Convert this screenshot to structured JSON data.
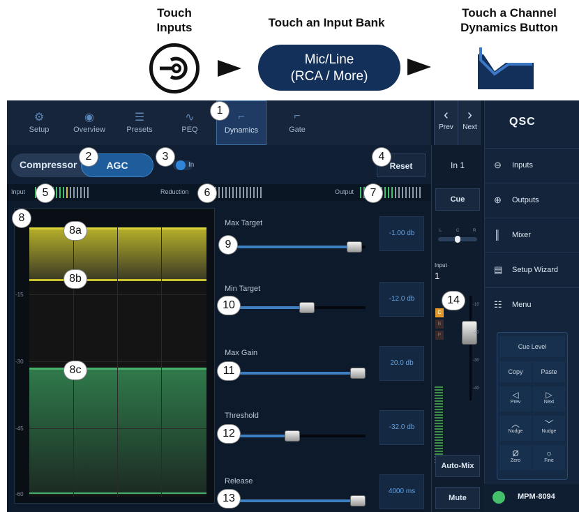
{
  "instructions": {
    "step1": "Touch\nInputs",
    "step2": "Touch an Input Bank",
    "step3": "Touch a Channel\nDynamics Button",
    "bank_button": "Mic/Line\n(RCA / More)"
  },
  "tabs": [
    {
      "label": "Setup",
      "icon": "gear-icon"
    },
    {
      "label": "Overview",
      "icon": "eye-icon"
    },
    {
      "label": "Presets",
      "icon": "sliders-icon"
    },
    {
      "label": "PEQ",
      "icon": "eq-curve-icon"
    },
    {
      "label": "Dynamics",
      "icon": "dynamics-icon",
      "active": true
    },
    {
      "label": "Gate",
      "icon": "gate-icon"
    }
  ],
  "nav": {
    "prev": "Prev",
    "next": "Next"
  },
  "mode": {
    "compressor": "Compressor",
    "agc": "AGC",
    "toggle_label": "In",
    "reset": "Reset"
  },
  "meters": {
    "input": "Input",
    "reduction": "Reduction",
    "output": "Output"
  },
  "graph": {
    "ticks": [
      "-15",
      "-30",
      "-45",
      "-60"
    ]
  },
  "params": [
    {
      "label": "Max Target",
      "value": "-1.00 db",
      "level": 0.97
    },
    {
      "label": "Min Target",
      "value": "-12.0 db",
      "level": 0.55
    },
    {
      "label": "Max Gain",
      "value": "20.0 db",
      "level": 1.0
    },
    {
      "label": "Threshold",
      "value": "-32.0 db",
      "level": 0.42
    },
    {
      "label": "Release",
      "value": "4000 ms",
      "level": 1.0
    }
  ],
  "channel": {
    "name": "In 1",
    "cue": "Cue",
    "pan": [
      "L",
      "C",
      "R"
    ],
    "input_label": "Input",
    "input_number": "1",
    "layers": [
      "C",
      "B",
      "P"
    ],
    "fader_ticks": [
      "-10",
      "-20",
      "-30",
      "-40"
    ],
    "automix": "Auto-Mix",
    "mute": "Mute"
  },
  "sidebar": {
    "logo": "QSC",
    "items": [
      {
        "label": "Inputs",
        "icon": "input-icon"
      },
      {
        "label": "Outputs",
        "icon": "output-icon"
      },
      {
        "label": "Mixer",
        "icon": "mixer-icon"
      },
      {
        "label": "Setup Wizard",
        "icon": "clipboard-icon"
      },
      {
        "label": "Menu",
        "icon": "menu-icon"
      }
    ],
    "keypad": {
      "cue_level": "Cue Level",
      "copy": "Copy",
      "paste": "Paste",
      "prev": "Prev",
      "next": "Next",
      "nudge_up": "Nudge",
      "nudge_down": "Nudge",
      "zero": "Zero",
      "fine": "Fine"
    },
    "device": "MPM-8094"
  },
  "callouts": [
    "1",
    "2",
    "3",
    "4",
    "5",
    "6",
    "7",
    "8",
    "8a",
    "8b",
    "8c",
    "9",
    "10",
    "11",
    "12",
    "13",
    "14"
  ],
  "colors": {
    "accent": "#1f5c9c",
    "active_blue": "#3d7fc0",
    "target_yellow": "#d8d23a",
    "gain_green": "#3f9a5c",
    "bank_navy": "#13305a"
  }
}
